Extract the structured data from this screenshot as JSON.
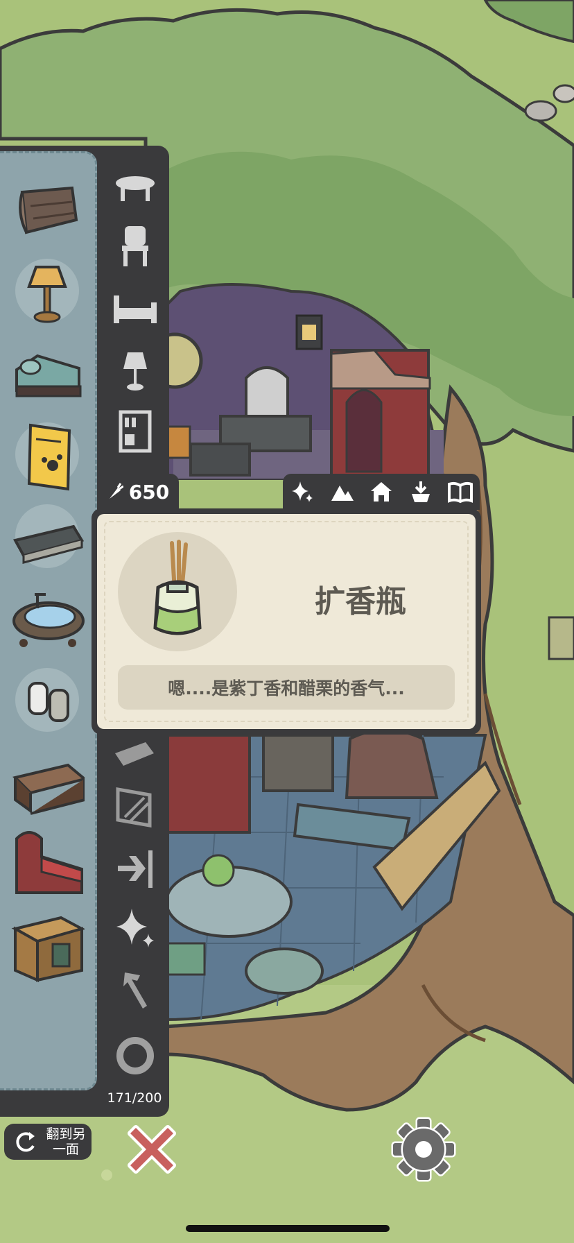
{
  "currency": {
    "icon": "carrot-icon",
    "amount": "650"
  },
  "inventory": {
    "count": "171/200",
    "items": [
      {
        "name": "wood-plank-rug"
      },
      {
        "name": "table-lamp"
      },
      {
        "name": "green-chaise-sofa"
      },
      {
        "name": "yellow-poster"
      },
      {
        "name": "marble-bench"
      },
      {
        "name": "clawfoot-bathtub"
      },
      {
        "name": "salt-pepper-shakers"
      },
      {
        "name": "wooden-coffee-table"
      },
      {
        "name": "red-gothic-bed"
      },
      {
        "name": "wooden-crate-shelf"
      }
    ]
  },
  "categories": [
    {
      "icon": "table-icon"
    },
    {
      "icon": "chair-icon"
    },
    {
      "icon": "bed-icon"
    },
    {
      "icon": "lamp-icon"
    },
    {
      "icon": "bookshelf-icon"
    },
    {
      "icon": "floor-icon"
    },
    {
      "icon": "wall-icon"
    },
    {
      "icon": "door-icon"
    },
    {
      "icon": "sparkle-icon"
    },
    {
      "icon": "tools-icon"
    },
    {
      "icon": "ring-icon"
    }
  ],
  "tabs": [
    {
      "icon": "sparkle-icon"
    },
    {
      "icon": "mountain-icon"
    },
    {
      "icon": "house-icon"
    },
    {
      "icon": "store-icon"
    },
    {
      "icon": "book-icon"
    }
  ],
  "selected_item": {
    "name": "扩香瓶",
    "description": "嗯....是紫丁香和醋栗的香气..."
  },
  "controls": {
    "flip_label": "翻到另一面",
    "close_icon": "close-icon",
    "settings_icon": "gear-icon"
  },
  "colors": {
    "panel_dark": "#3a3a3c",
    "item_column": "#8ea4ab",
    "card_bg": "#efe9d8",
    "close_red": "#c8605e"
  }
}
